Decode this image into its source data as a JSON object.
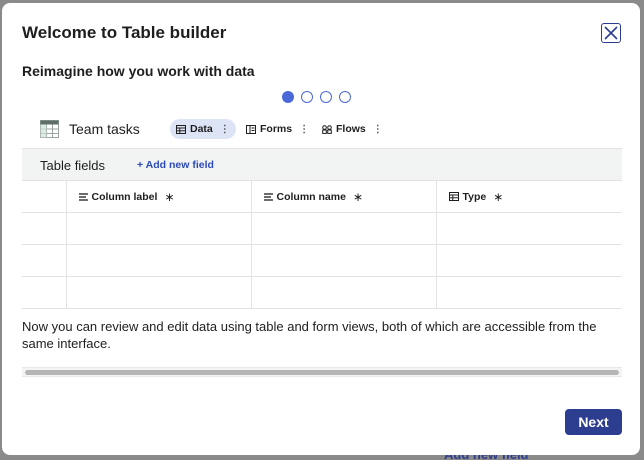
{
  "backdrop": {
    "link_text": "Add new field"
  },
  "modal": {
    "title": "Welcome to Table builder",
    "subtitle": "Reimagine how you work with data",
    "steps": {
      "current": 1,
      "total": 4
    },
    "description": "Now you can review and edit data using table and form views, both of which are accessible from the same interface.",
    "next_label": "Next"
  },
  "preview": {
    "app_title": "Team tasks",
    "tabs": [
      {
        "label": "Data",
        "icon": "table-icon",
        "active": true
      },
      {
        "label": "Forms",
        "icon": "form-icon",
        "active": false
      },
      {
        "label": "Flows",
        "icon": "flow-icon",
        "active": false
      }
    ],
    "fields_title": "Table fields",
    "add_field_label": "+ Add new field",
    "columns": [
      {
        "label": "Column label",
        "icon": "text-lines-icon",
        "required_marker": "∗"
      },
      {
        "label": "Column name",
        "icon": "text-lines-icon",
        "required_marker": "∗"
      },
      {
        "label": "Type",
        "icon": "table-icon",
        "required_marker": "∗"
      }
    ]
  },
  "colors": {
    "primary": "#2d3d8f",
    "accent": "#4a68d8",
    "tab_active_bg": "#dde4f6",
    "link": "#2d4bb8"
  }
}
